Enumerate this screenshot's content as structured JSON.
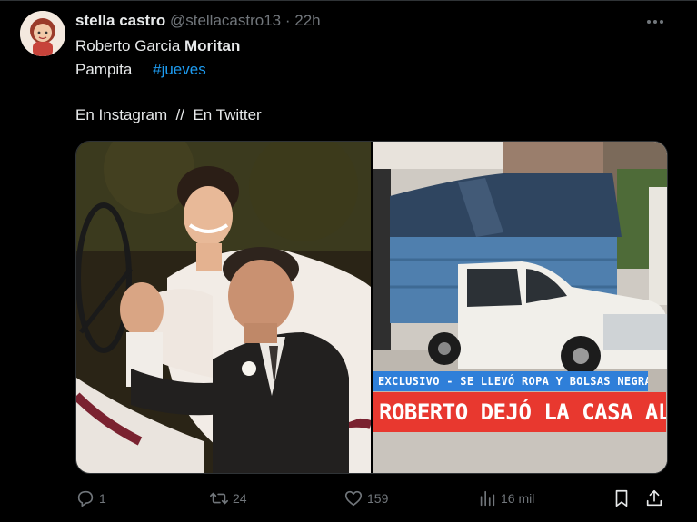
{
  "tweet": {
    "display_name": "stella castro",
    "handle": "@stellacastro13",
    "separator": "·",
    "time": "22h",
    "line1_normal": "Roberto Garcia",
    "line1_bold": "Moritan",
    "line2_text": "Pampita",
    "line2_hashtag": "#jueves",
    "line3": "En Instagram  //  En Twitter"
  },
  "media": {
    "overlay_small": "EXCLUSIVO - SE LLEVÓ ROPA Y BOLSAS NEGRAS",
    "overlay_big": "ROBERTO DEJÓ LA CASA AL ME"
  },
  "actions": {
    "replies": "1",
    "retweets": "24",
    "likes": "159",
    "views": "16 mil"
  },
  "icons": {
    "more": "more-dots-icon",
    "reply": "reply-icon",
    "retweet": "retweet-icon",
    "like": "heart-icon",
    "views": "views-icon",
    "bookmark": "bookmark-icon",
    "share": "share-icon"
  },
  "colors": {
    "background": "#000000",
    "text": "#e7e9ea",
    "muted": "#71767b",
    "link": "#1d9bf0",
    "overlay_blue": "#2f7fd9",
    "overlay_red": "#e8382f"
  }
}
